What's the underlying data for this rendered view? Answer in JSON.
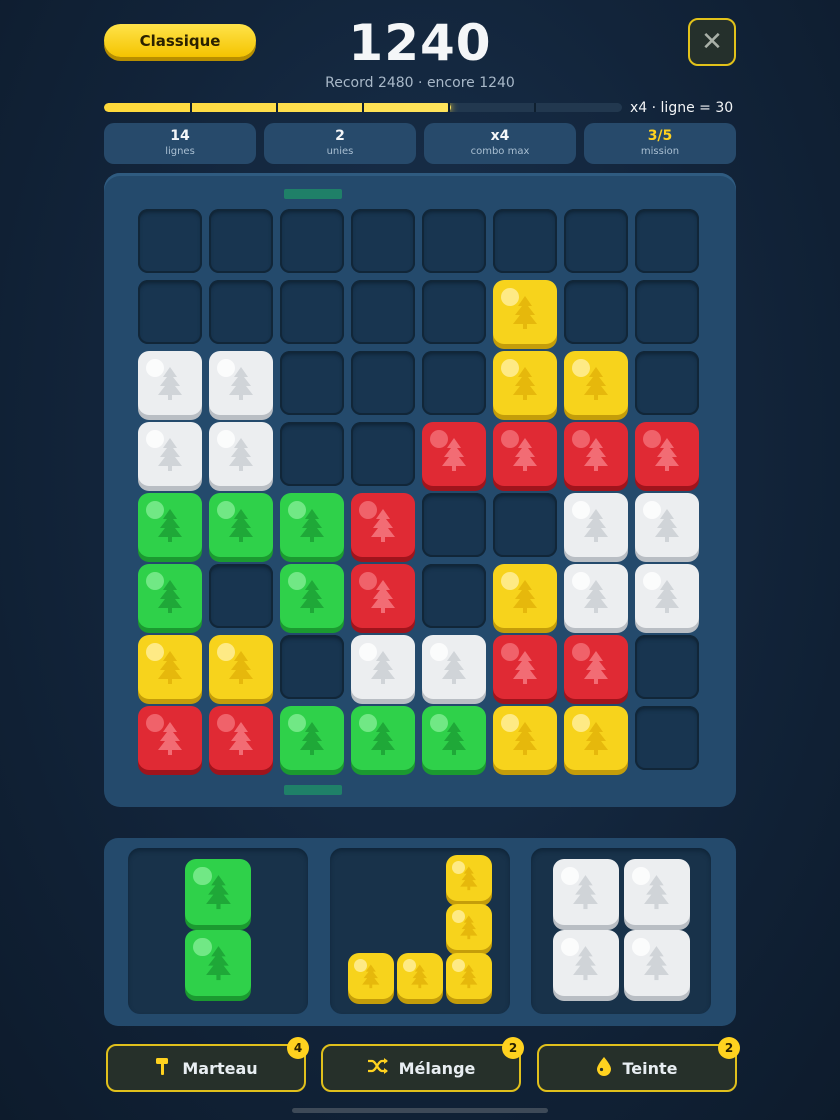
{
  "header": {
    "mode_label": "Classique",
    "score": "1240",
    "record_text": "Record 2480 · encore 1240",
    "close_icon": "close-icon",
    "combo_text": "x4 · ligne = 30"
  },
  "progress": {
    "fraction": 0.67,
    "segments": 6
  },
  "stats": [
    {
      "value": "14",
      "label": "lignes"
    },
    {
      "value": "2",
      "label": "unies"
    },
    {
      "value": "x4",
      "label": "combo max"
    },
    {
      "value": "3/5",
      "label": "mission",
      "value_color": "#ffd21f"
    }
  ],
  "colors": {
    "Y": {
      "main": "#f7d31c",
      "dark": "#c49d0a",
      "light": "#fff0a0",
      "tree": "#e6b80c"
    },
    "W": {
      "main": "#eceef0",
      "dark": "#b9bec4",
      "light": "#ffffff",
      "tree": "#d0d4d8"
    },
    "R": {
      "main": "#e02a34",
      "dark": "#a0141c",
      "light": "#f47178",
      "tree": "#f26c74"
    },
    "G": {
      "main": "#2fd14a",
      "dark": "#1b9a30",
      "light": "#82ee94",
      "tree": "#1fa838"
    }
  },
  "board": [
    "........",
    ".....Y..",
    "WW...YY.",
    "WW..RRRR",
    "GGGR..WW",
    "G.GR.YWW",
    "YY.WWRR.",
    "RRGGGYY."
  ],
  "pieces": [
    {
      "color": "G",
      "cells": [
        [
          0,
          0
        ],
        [
          0,
          1
        ]
      ]
    },
    {
      "color": "Y",
      "cells": [
        [
          2,
          0
        ],
        [
          2,
          1
        ],
        [
          0,
          2
        ],
        [
          1,
          2
        ],
        [
          2,
          2
        ]
      ]
    },
    {
      "color": "W",
      "cells": [
        [
          0,
          0
        ],
        [
          1,
          0
        ],
        [
          0,
          1
        ],
        [
          1,
          1
        ]
      ]
    }
  ],
  "powerups": [
    {
      "label": "Marteau",
      "icon": "hammer-icon",
      "count": "4"
    },
    {
      "label": "Mélange",
      "icon": "shuffle-icon",
      "count": "2"
    },
    {
      "label": "Teinte",
      "icon": "drop-icon",
      "count": "2"
    }
  ]
}
